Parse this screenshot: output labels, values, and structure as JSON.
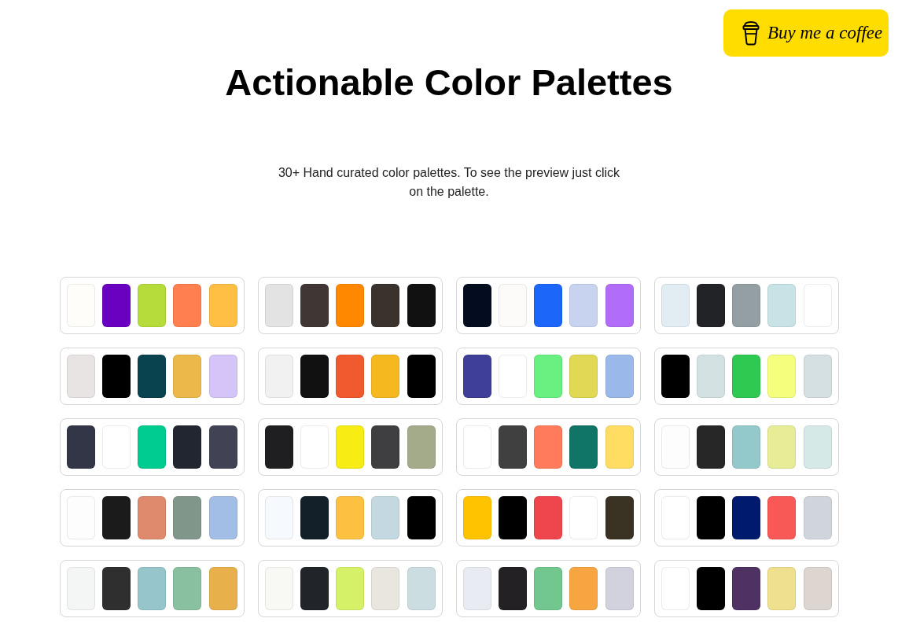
{
  "header": {
    "button": {
      "label": "Buy me a coffee"
    }
  },
  "title": "Actionable Color Palettes",
  "subtitle": "30+ Hand curated color palettes. To see the preview just click on the palette.",
  "palettes": [
    {
      "swatches": [
        {
          "color": "#fffdfa"
        },
        {
          "color": "#6a00c0"
        },
        {
          "color": "#b5dc3a"
        },
        {
          "color": "#ff7f50"
        },
        {
          "color": "#ffbe44"
        }
      ]
    },
    {
      "swatches": [
        {
          "color": "#e3e3e3"
        },
        {
          "color": "#403634"
        },
        {
          "color": "#ff8800"
        },
        {
          "color": "#3a322c"
        },
        {
          "color": "#111111"
        }
      ]
    },
    {
      "swatches": [
        {
          "color": "#040d1f"
        },
        {
          "color": "#fcfbf9"
        },
        {
          "color": "#1d66fa"
        },
        {
          "color": "#c8d4ef"
        },
        {
          "color": "#b26df8"
        }
      ]
    },
    {
      "swatches": [
        {
          "color": "#e1ecf3"
        },
        {
          "color": "#222326"
        },
        {
          "color": "#939fa2"
        },
        {
          "color": "#c8e3e6"
        },
        {
          "color": "#ffffff"
        }
      ]
    },
    {
      "swatches": [
        {
          "color": "#e9e4e4"
        },
        {
          "color": "#000000"
        },
        {
          "color": "#08434f"
        },
        {
          "color": "#edb84a"
        },
        {
          "color": "#d5c4f8"
        }
      ]
    },
    {
      "swatches": [
        {
          "color": "#f1f1f1"
        },
        {
          "color": "#111111"
        },
        {
          "color": "#f05a2e"
        },
        {
          "color": "#f5b91f"
        },
        {
          "color": "#000000"
        }
      ]
    },
    {
      "swatches": [
        {
          "color": "#3f3f99"
        },
        {
          "color": "#ffffff"
        },
        {
          "color": "#68f080"
        },
        {
          "color": "#e1d853"
        },
        {
          "color": "#9ab9ea"
        }
      ]
    },
    {
      "swatches": [
        {
          "color": "#000000"
        },
        {
          "color": "#d4e1e3"
        },
        {
          "color": "#2ec950"
        },
        {
          "color": "#f5ff7d"
        },
        {
          "color": "#d5e0e2"
        }
      ]
    },
    {
      "swatches": [
        {
          "color": "#333647"
        },
        {
          "color": "#ffffff"
        },
        {
          "color": "#00cc90"
        },
        {
          "color": "#222631"
        },
        {
          "color": "#414253"
        }
      ]
    },
    {
      "swatches": [
        {
          "color": "#1f1f22"
        },
        {
          "color": "#ffffff"
        },
        {
          "color": "#f7ec14"
        },
        {
          "color": "#3f3f41"
        },
        {
          "color": "#a4ab8a"
        }
      ]
    },
    {
      "swatches": [
        {
          "color": "#ffffff"
        },
        {
          "color": "#404040"
        },
        {
          "color": "#ff7b5c"
        },
        {
          "color": "#107466"
        },
        {
          "color": "#ffdd63"
        }
      ]
    },
    {
      "swatches": [
        {
          "color": "#fdfdfd"
        },
        {
          "color": "#272727"
        },
        {
          "color": "#94c9cb"
        },
        {
          "color": "#e7ec96"
        },
        {
          "color": "#d5e9e7"
        }
      ]
    },
    {
      "swatches": [
        {
          "color": "#fdfdfd"
        },
        {
          "color": "#1b1b1b"
        },
        {
          "color": "#df8a6c"
        },
        {
          "color": "#80968a"
        },
        {
          "color": "#a2bde6"
        }
      ]
    },
    {
      "swatches": [
        {
          "color": "#f6f9fd"
        },
        {
          "color": "#13202a"
        },
        {
          "color": "#fdc141"
        },
        {
          "color": "#c3d8e0"
        },
        {
          "color": "#000000"
        }
      ]
    },
    {
      "swatches": [
        {
          "color": "#ffc300"
        },
        {
          "color": "#000000"
        },
        {
          "color": "#ef454c"
        },
        {
          "color": "#ffffff"
        },
        {
          "color": "#3a3323"
        }
      ]
    },
    {
      "swatches": [
        {
          "color": "#ffffff"
        },
        {
          "color": "#000000"
        },
        {
          "color": "#001a6e"
        },
        {
          "color": "#f85957"
        },
        {
          "color": "#d0d5dc"
        }
      ]
    },
    {
      "swatches": [
        {
          "color": "#f4f6f5"
        },
        {
          "color": "#2f2f2f"
        },
        {
          "color": "#96c5cb"
        },
        {
          "color": "#89c09f"
        },
        {
          "color": "#e8b04b"
        }
      ]
    },
    {
      "swatches": [
        {
          "color": "#f8f9f5"
        },
        {
          "color": "#212529"
        },
        {
          "color": "#d5f168"
        },
        {
          "color": "#e8e6df"
        },
        {
          "color": "#ccdde2"
        }
      ]
    },
    {
      "swatches": [
        {
          "color": "#e9ebf3"
        },
        {
          "color": "#232123"
        },
        {
          "color": "#71c78e"
        },
        {
          "color": "#f6a540"
        },
        {
          "color": "#d1d2dd"
        }
      ]
    },
    {
      "swatches": [
        {
          "color": "#ffffff"
        },
        {
          "color": "#000000"
        },
        {
          "color": "#4f3163"
        },
        {
          "color": "#eee08f"
        },
        {
          "color": "#ddd5cf"
        }
      ]
    }
  ]
}
